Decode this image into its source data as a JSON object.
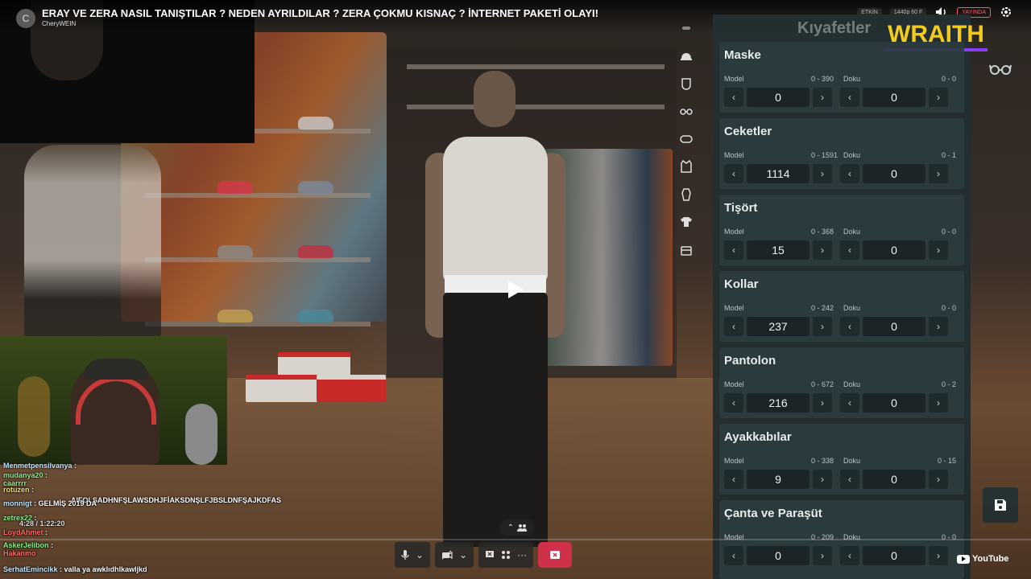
{
  "video": {
    "channel_initial": "C",
    "title": "ERAY VE ZERA NASIL TANIŞTILAR ? NEDEN AYRILDILAR ? ZERA ÇOKMU KISNAÇ ? İNTERNET PAKETİ OLAYI!",
    "channel": "CheryWEIN"
  },
  "top_bar": {
    "badge_1": "ETKİN",
    "badge_2": "1440p 60 F",
    "badge_live": "YAYINDA"
  },
  "brand": {
    "overlay_logo": "WRAITH",
    "overlay_color": "#f3cb1c"
  },
  "panel": {
    "title": "Kıyafetler",
    "model_label": "Model",
    "doku_label": "Doku",
    "sections": [
      {
        "title": "Maske",
        "model_range": "0 - 390",
        "doku_range": "0 - 0",
        "model_value": "0",
        "doku_value": "0"
      },
      {
        "title": "Ceketler",
        "model_range": "0 - 1591",
        "doku_range": "0 - 1",
        "model_value": "1114",
        "doku_value": "0"
      },
      {
        "title": "Tişört",
        "model_range": "0 - 368",
        "doku_range": "0 - 0",
        "model_value": "15",
        "doku_value": "0"
      },
      {
        "title": "Kollar",
        "model_range": "0 - 242",
        "doku_range": "0 - 0",
        "model_value": "237",
        "doku_value": "0"
      },
      {
        "title": "Pantolon",
        "model_range": "0 - 672",
        "doku_range": "0 - 2",
        "model_value": "216",
        "doku_value": "0"
      },
      {
        "title": "Ayakkabılar",
        "model_range": "0 - 338",
        "doku_range": "0 - 15",
        "model_value": "9",
        "doku_value": "0"
      },
      {
        "title": "Çanta ve Paraşüt",
        "model_range": "0 - 209",
        "doku_range": "0 - 0",
        "model_value": "0",
        "doku_value": "0"
      }
    ]
  },
  "chat": {
    "lines": [
      {
        "user": "Menmetpensilvanya",
        "text": ""
      },
      {
        "user": "mudanya20",
        "text": ""
      },
      {
        "user": "caarrrr",
        "text": ""
      },
      {
        "user": "rotuzen",
        "text": ""
      },
      {
        "user": "",
        "text": "AIFOLSADHNFŞLAWSDHJFİAKSDNŞLFJBSLDNFŞAJKDFAS"
      },
      {
        "user": "monnigt",
        "text": "GELMİŞ 2019 DA"
      },
      {
        "user": "zetrex22",
        "text": ""
      },
      {
        "user": "",
        "text": "4:28 / 1:22:20"
      },
      {
        "user": "LoydAhmet",
        "text": ""
      },
      {
        "user": "AskerJelibon",
        "text": ""
      },
      {
        "user": "Hakanmo",
        "text": ""
      },
      {
        "user": "SerhatEmincikk",
        "text": "valla ya awklıdhlkawljkd"
      }
    ]
  },
  "footer": {
    "youtube_label": "YouTube",
    "end_call_color": "#d0314a"
  }
}
